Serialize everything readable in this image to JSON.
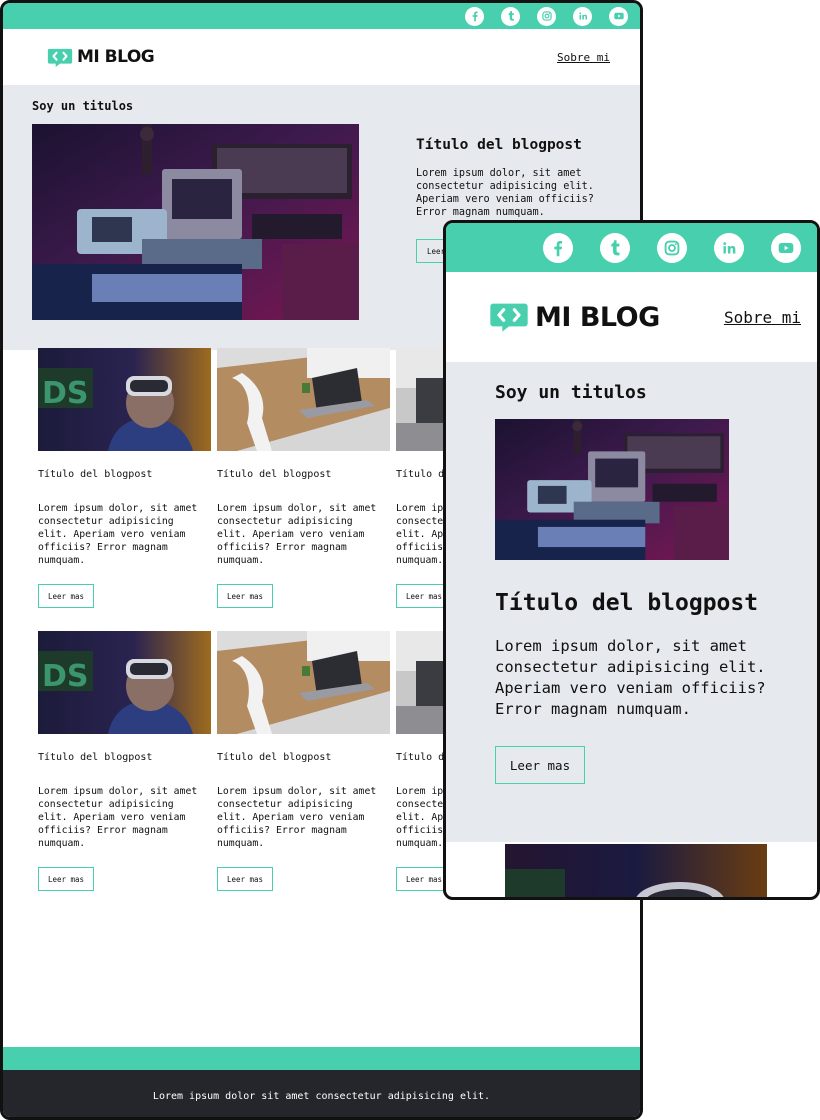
{
  "colors": {
    "accent": "#48cfad",
    "hero_bg": "#e6e9ed",
    "footer_bg": "#24262b"
  },
  "social_icons": [
    "facebook-icon",
    "tumblr-icon",
    "instagram-icon",
    "linkedin-icon",
    "youtube-icon"
  ],
  "brand": {
    "name": "MI BLOG",
    "logo_icon": "code-bubble-icon"
  },
  "nav": {
    "about": "Sobre mi"
  },
  "hero": {
    "section_label": "Soy un titulos",
    "post_title": "Título del blogpost",
    "body": "Lorem ipsum dolor, sit amet consectetur adipisicing elit. Aperiam vero veniam officiis? Error magnam numquam.",
    "button": "Leer mas",
    "image": "retro-computers-photo"
  },
  "posts": [
    {
      "title": "Título del blogpost",
      "body": "Lorem ipsum dolor, sit amet consectetur adipisicing elit. Aperiam vero veniam officiis? Error magnam numquam.",
      "button": "Leer mas",
      "image": "vr-headset-photo"
    },
    {
      "title": "Título del blogpost",
      "body": "Lorem ipsum dolor, sit amet consectetur adipisicing elit. Aperiam vero veniam officiis? Error magnam numquam.",
      "button": "Leer mas",
      "image": "laptop-desk-photo"
    },
    {
      "title": "Título del blogpost",
      "body": "Lorem ipsum dolor, sit amet consectetur adipisicing elit. Aperiam vero veniam officiis? Error magnam numquam.",
      "button": "Leer mas",
      "image": "laptop-closeup-photo"
    },
    {
      "title": "Título del blogpost",
      "body": "Lorem ipsum dolor, sit amet consectetur adipisicing elit. Aperiam vero veniam officiis? Error magnam numquam.",
      "button": "Leer mas",
      "image": "vr-headset-photo"
    },
    {
      "title": "Título del blogpost",
      "body": "Lorem ipsum dolor, sit amet consectetur adipisicing elit. Aperiam vero veniam officiis? Error magnam numquam.",
      "button": "Leer mas",
      "image": "laptop-desk-photo"
    },
    {
      "title": "Título del blogpost",
      "body": "Lorem ipsum dolor, sit amet consectetur adipisicing elit. Aperiam vero veniam officiis? Error magnam numquam.",
      "button": "Leer mas",
      "image": "laptop-closeup-photo"
    }
  ],
  "footer": {
    "text": "Lorem ipsum dolor sit amet consectetur adipisicing elit."
  }
}
